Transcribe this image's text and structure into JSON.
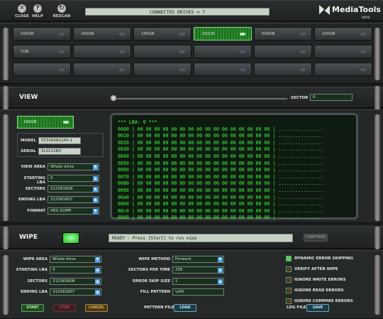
{
  "toolbar": {
    "close_label": "CLOSE",
    "help_label": "HELP",
    "rescan_label": "RESCAN",
    "connected_drives": "CONNECTED DRIVES = 7",
    "logo_text": "MediaTools",
    "logo_sub": "WIPE"
  },
  "bay": {
    "slots": [
      {
        "label": "500GB"
      },
      {
        "label": "250GB"
      },
      {
        "label": "250GB"
      },
      {
        "label": "160GB"
      },
      {
        "label": "500GB"
      },
      {
        "label": "320GB"
      },
      {
        "label": "1GB"
      },
      {
        "label": ""
      },
      {
        "label": ""
      },
      {
        "label": ""
      },
      {
        "label": ""
      },
      {
        "label": ""
      },
      {
        "label": ""
      },
      {
        "label": ""
      },
      {
        "label": ""
      },
      {
        "label": ""
      },
      {
        "label": ""
      },
      {
        "label": ""
      }
    ],
    "selected_index": 3
  },
  "view": {
    "title": "VIEW",
    "sector_label": "SECTOR",
    "sector_value": "0",
    "selected_drive_label": "160GB",
    "model_label": "MODEL",
    "model_value": "ST3160812AS-1",
    "serial_label": "SERIAL",
    "serial_value": "5LS232BD",
    "view_area_label": "VIEW AREA",
    "view_area_value": "Whole drive",
    "starting_lba_label": "STARTING LBA",
    "starting_lba_value": "0",
    "sectors_label": "SECTORS",
    "sectors_value": "312581808",
    "ending_lba_label": "ENDING LBA",
    "ending_lba_value": "312581807",
    "format_label": "FORMAT",
    "format_value": "HEX DUMP",
    "hex_dump": "*** LBA: 0 ***\n0000 | 00 00 00 00 00 00 00 00 00 00 00 00 00 00 00 00 | ................\n0010 | 00 00 00 00 00 00 00 00 00 00 00 00 00 00 00 00 | ................\n0020 | 00 00 00 00 00 00 00 00 00 00 00 00 00 00 00 00 | ................\n0030 | 00 00 00 00 00 00 00 00 00 00 00 00 00 00 00 00 | ................\n0040 | 00 00 00 00 00 00 00 00 00 00 00 00 00 00 00 00 | ................\n0050 | 00 00 00 00 00 00 00 00 00 00 00 00 00 00 00 00 | ................\n0060 | 00 00 00 00 00 00 00 00 00 00 00 00 00 00 00 00 | ................\n0070 | 00 00 00 00 00 00 00 00 00 00 00 00 00 00 00 00 | ................\n0080 | 00 00 00 00 00 00 00 00 00 00 00 00 00 00 00 00 | ................\n0090 | 00 00 00 00 00 00 00 00 00 00 00 00 00 00 00 00 | ................\n00a0 | 00 00 00 00 00 00 00 00 00 00 00 00 00 00 00 00 | ................\n00b0 | 00 00 00 00 00 00 00 00 00 00 00 00 00 00 00 00 | ................\n00c0 | 00 00 00 00 00 00 00 00 00 00 00 00 00 00 00 00 | ................\n00d0 | 00 00 00 00 00 00 00 00 00 00 00 00 00 00 00 00 | ................"
  },
  "wipe": {
    "title": "WIPE",
    "status": "READY - Press [Start] to run wipe",
    "continue_label": "CONTINUE",
    "wipe_area_label": "WIPE AREA",
    "wipe_area_value": "Whole drive",
    "starting_lba_label": "STARTING LBA",
    "starting_lba_value": "0",
    "sectors_label": "SECTORS",
    "sectors_value": "312581808",
    "ending_lba_label": "ENDING LBA",
    "ending_lba_value": "312581807",
    "method_label": "WIPE METHOD",
    "method_value": "Forward",
    "sectors_per_time_label": "SECTORS PER TIME",
    "sectors_per_time_value": "256",
    "error_skip_label": "ERROR SKIP SIZE",
    "error_skip_value": "1",
    "fill_pattern_label": "FILL PATTERN",
    "fill_pattern_value": "\\x00",
    "pattern_file_label": "PATTERN FILE",
    "load_label": "LOAD",
    "log_file_label": "LOG FILE",
    "save_label": "SAVE",
    "start_label": "START",
    "stop_label": "STOP",
    "cancel_label": "CANCEL",
    "options": [
      {
        "label": "DYNAMIC ERROR SKIPPING",
        "state": "on"
      },
      {
        "label": "VERIFY AFTER WIPE",
        "state": "x"
      },
      {
        "label": "IGNORE WRITE ERRORS",
        "state": "x"
      },
      {
        "label": "IGNORE READ ERRORS",
        "state": "x"
      },
      {
        "label": "IGNORE COMPARE ERRORS",
        "state": "x"
      }
    ]
  },
  "colors": {
    "accent_green": "#39ff39",
    "panel": "#2b2e30",
    "led_green": "#12c012"
  }
}
